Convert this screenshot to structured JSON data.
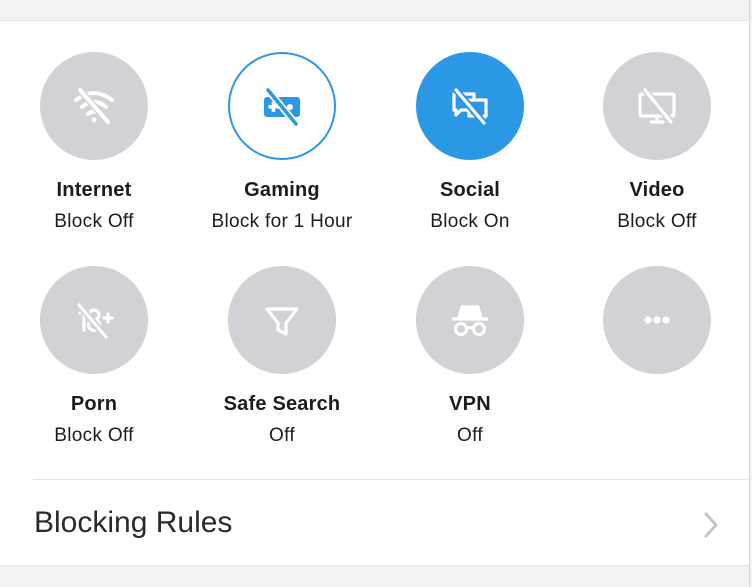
{
  "tiles": [
    {
      "title": "Internet",
      "status": "Block Off",
      "icon": "wifi-off-icon",
      "state": "off"
    },
    {
      "title": "Gaming",
      "status": "Block for 1 Hour",
      "icon": "gamepad-off-icon",
      "state": "timed"
    },
    {
      "title": "Social",
      "status": "Block On",
      "icon": "chat-off-icon",
      "state": "on"
    },
    {
      "title": "Video",
      "status": "Block Off",
      "icon": "monitor-off-icon",
      "state": "off"
    },
    {
      "title": "Porn",
      "status": "Block Off",
      "icon": "eighteen-plus-off-icon",
      "state": "off"
    },
    {
      "title": "Safe Search",
      "status": "Off",
      "icon": "filter-icon",
      "state": "off"
    },
    {
      "title": "VPN",
      "status": "Off",
      "icon": "incognito-icon",
      "state": "off"
    },
    {
      "title": "",
      "status": "",
      "icon": "more-icon",
      "state": "off"
    }
  ],
  "blocking_rules": {
    "label": "Blocking Rules",
    "icon": "chevron-right-icon"
  },
  "colors": {
    "accent": "#2b98e5",
    "inactive": "#d1d1d6",
    "icon_light": "#ffffff"
  }
}
